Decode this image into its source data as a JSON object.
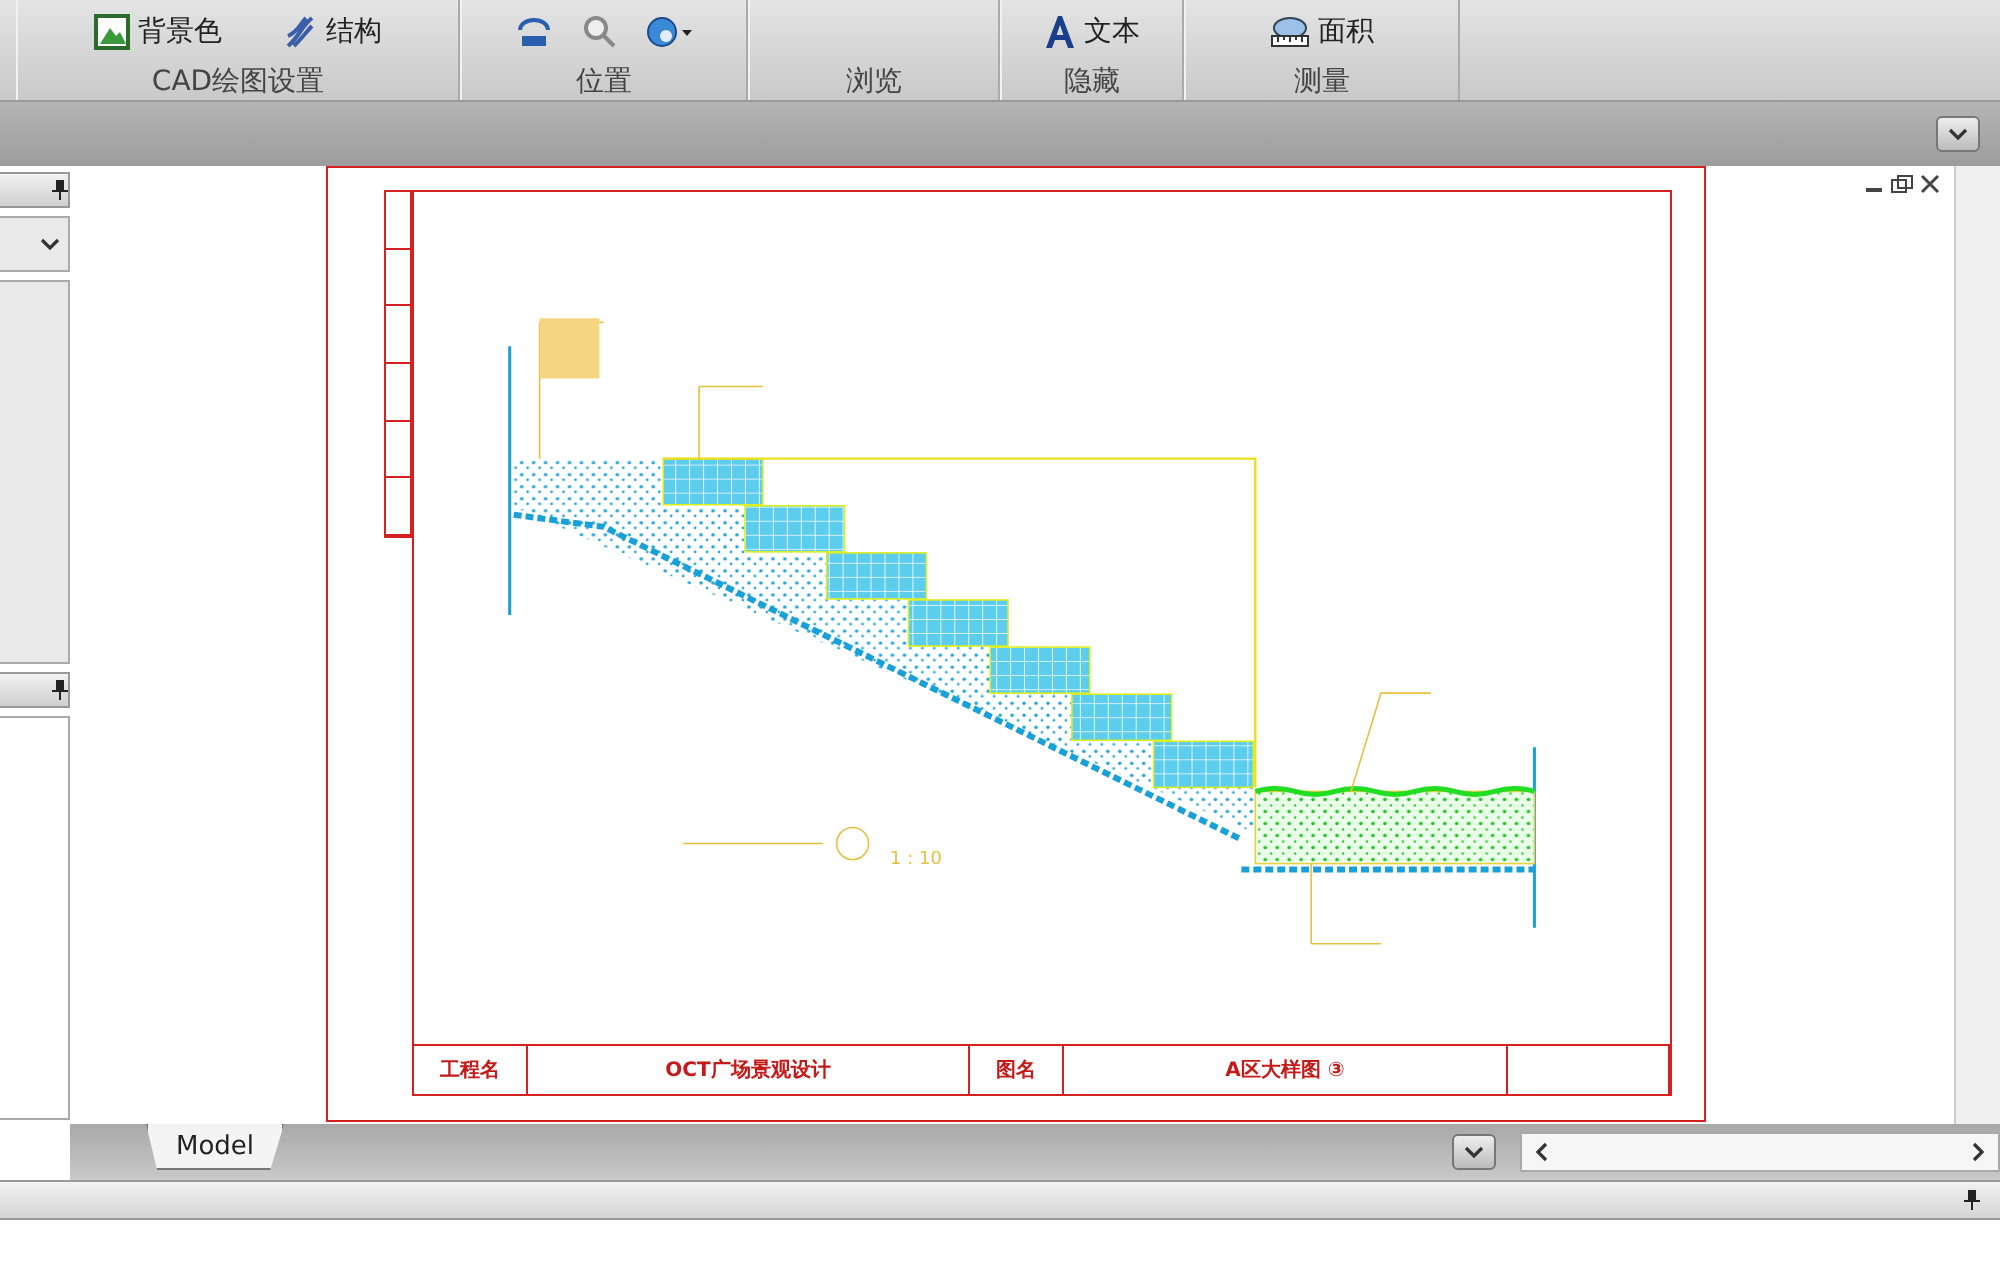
{
  "ribbon": {
    "groups": [
      {
        "label": "CAD绘图设置",
        "buttons": [
          {
            "label": "背景色",
            "kind": "background"
          },
          {
            "label": "结构",
            "kind": "structure"
          }
        ]
      },
      {
        "label": "位置",
        "tools": [
          {
            "kind": "rotate"
          },
          {
            "kind": "zoom"
          },
          {
            "kind": "orbit"
          }
        ]
      },
      {
        "label": "浏览"
      },
      {
        "label": "隐藏",
        "buttons": [
          {
            "label": "文本",
            "kind": "text"
          }
        ]
      },
      {
        "label": "测量",
        "buttons": [
          {
            "label": "面积",
            "kind": "area"
          }
        ]
      }
    ]
  },
  "drawing": {
    "scale": "1 : 10",
    "title_block": {
      "project_label": "工程名",
      "project": "OCT广场景观设计",
      "drawing_label": "图名",
      "drawing": "A区大样图",
      "detail_mark": "③"
    }
  },
  "layout_tabs": [
    {
      "label": "Model",
      "selected": true
    }
  ]
}
